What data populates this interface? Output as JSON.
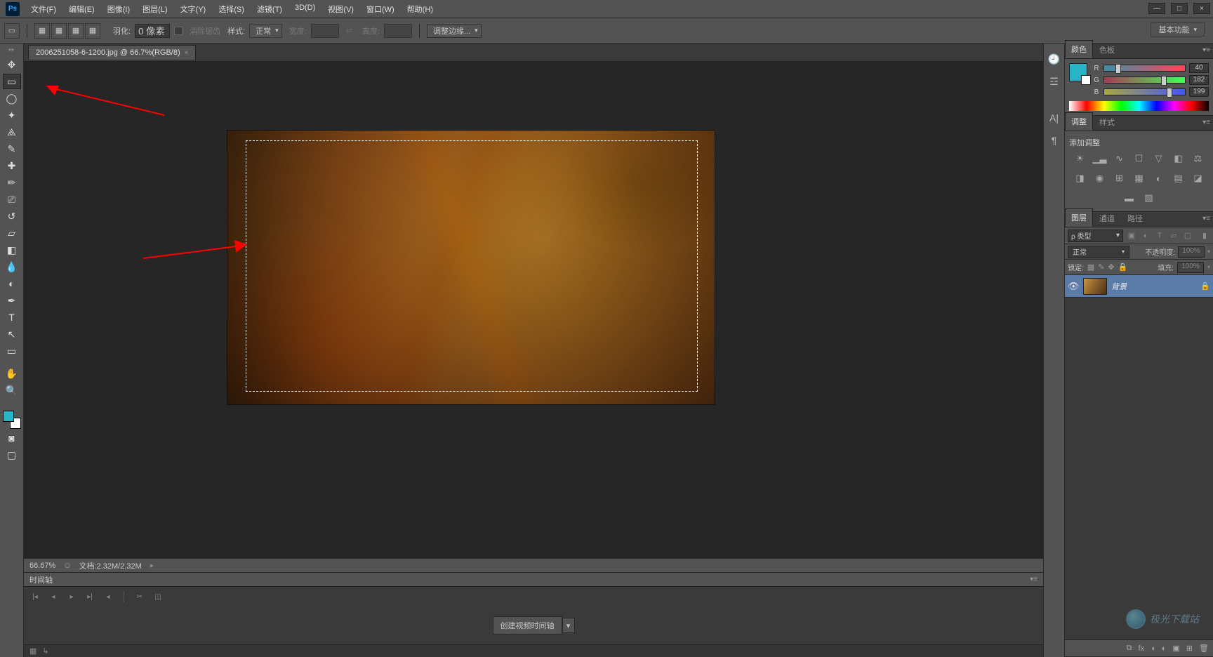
{
  "app": {
    "logo": "Ps"
  },
  "menu": {
    "file": "文件(F)",
    "edit": "编辑(E)",
    "image": "图像(I)",
    "layer": "图层(L)",
    "type": "文字(Y)",
    "select": "选择(S)",
    "filter": "滤镜(T)",
    "3d": "3D(D)",
    "view": "视图(V)",
    "window": "窗口(W)",
    "help": "帮助(H)"
  },
  "window_controls": {
    "min": "—",
    "max": "□",
    "close": "×"
  },
  "options": {
    "feather_label": "羽化:",
    "feather_value": "0 像素",
    "antialias_label": "消除锯齿",
    "style_label": "样式:",
    "style_value": "正常",
    "width_label": "宽度:",
    "height_label": "高度:",
    "refine_edge": "调整边缘..."
  },
  "workspace": {
    "label": "基本功能"
  },
  "document": {
    "tab_title": "2006251058-6-1200.jpg @ 66.7%(RGB/8)"
  },
  "status": {
    "zoom": "66.67%",
    "doc_label": "文档:2.32M/2.32M"
  },
  "timeline": {
    "tab": "时间轴",
    "create_btn": "创建视频时间轴"
  },
  "panels": {
    "color_tab": "颜色",
    "swatches_tab": "色板",
    "r": "R",
    "r_val": "40",
    "g": "G",
    "g_val": "182",
    "b": "B",
    "b_val": "199",
    "adjust_tab": "调整",
    "styles_tab": "样式",
    "add_adjust": "添加调整",
    "layers_tab": "图层",
    "channels_tab": "通道",
    "paths_tab": "路径",
    "filter_kind": "ρ 类型",
    "blend_mode": "正常",
    "opacity_label": "不透明度:",
    "opacity_val": "100%",
    "lock_label": "锁定:",
    "fill_label": "填充:",
    "fill_val": "100%",
    "bg_layer": "背景"
  },
  "colors": {
    "fg": "#28b6c7"
  },
  "watermark": {
    "text": "极光下载站"
  }
}
